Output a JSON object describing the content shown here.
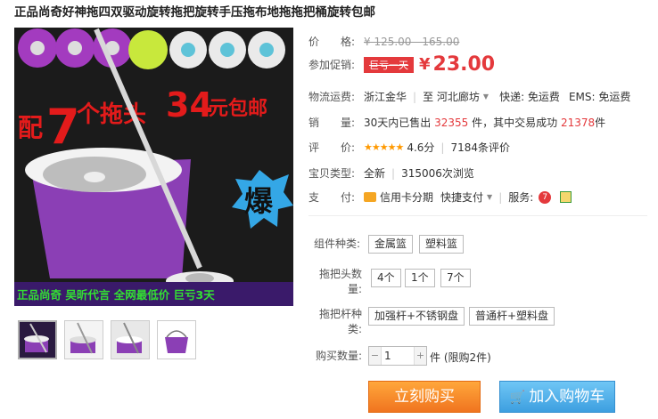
{
  "title": "正品尚奇好神拖四双驱动旋转拖把旋转手压拖布地拖拖把桶旋转包邮",
  "image": {
    "banner_count": "7",
    "banner_prefix": "配",
    "banner_mid": "个拖头",
    "banner_price": "34",
    "banner_suffix": "元包邮",
    "burst": "爆",
    "bottom_strip": "正品尚奇 吴昕代言 全网最低价 巨亏3天"
  },
  "price": {
    "label": "价　　格:",
    "original": "¥ 125.00 - 165.00"
  },
  "promo": {
    "label": "参加促销:",
    "tag": "巨亏一天",
    "yen": "¥",
    "price": "23.00"
  },
  "shipping": {
    "label": "物流运费:",
    "from": "浙江金华",
    "to": "河北廊坊",
    "express": "快递: 免运费",
    "ems": "EMS: 免运费"
  },
  "sales": {
    "label": "销　　量:",
    "prefix": "30天内已售出",
    "sold": "32355",
    "mid": "件，其中交易成功",
    "success": "21378",
    "suffix": "件"
  },
  "rating": {
    "label": "评　　价:",
    "stars": "★★★★★",
    "score": "4.6分",
    "count": "7184条评价"
  },
  "condition": {
    "label": "宝贝类型:",
    "type": "全新",
    "views": "315006次浏览"
  },
  "payment": {
    "label": "支　　付:",
    "credit": "信用卡分期",
    "quick": "快捷支付",
    "service_label": "服务:"
  },
  "options": {
    "group1": {
      "label": "组件种类:",
      "items": [
        "金属篮",
        "塑料篮"
      ]
    },
    "group2": {
      "label": "拖把头数量:",
      "items": [
        "4个",
        "1个",
        "7个"
      ]
    },
    "group3": {
      "label": "拖把杆种类:",
      "items": [
        "加强杆+不锈钢盘",
        "普通杆+塑料盘"
      ]
    }
  },
  "quantity": {
    "label": "购买数量:",
    "value": "1",
    "limit": "件 (限购2件)"
  },
  "buttons": {
    "buy": "立刻购买",
    "cart": "加入购物车"
  },
  "colors": {
    "accent": "#e4393c",
    "buy": "#f47920",
    "cart": "#49a9e8",
    "mop": "#8b3fb5"
  }
}
